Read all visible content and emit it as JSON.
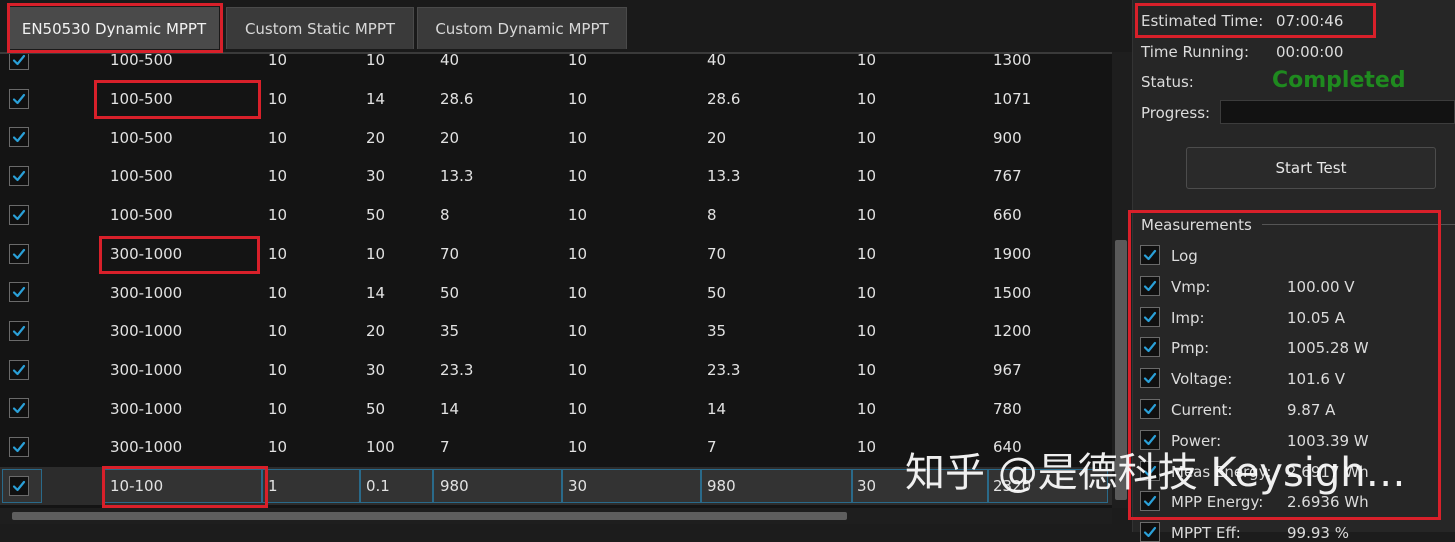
{
  "tabs": [
    {
      "label": "EN50530 Dynamic MPPT",
      "active": true
    },
    {
      "label": "Custom Static MPPT",
      "active": false
    },
    {
      "label": "Custom Dynamic MPPT",
      "active": false
    }
  ],
  "table": {
    "rows": [
      {
        "checked": true,
        "cells": [
          "100-500",
          "10",
          "10",
          "40",
          "10",
          "40",
          "10",
          "1300"
        ]
      },
      {
        "checked": true,
        "cells": [
          "100-500",
          "10",
          "14",
          "28.6",
          "10",
          "28.6",
          "10",
          "1071"
        ]
      },
      {
        "checked": true,
        "cells": [
          "100-500",
          "10",
          "20",
          "20",
          "10",
          "20",
          "10",
          "900"
        ]
      },
      {
        "checked": true,
        "cells": [
          "100-500",
          "10",
          "30",
          "13.3",
          "10",
          "13.3",
          "10",
          "767"
        ]
      },
      {
        "checked": true,
        "cells": [
          "100-500",
          "10",
          "50",
          "8",
          "10",
          "8",
          "10",
          "660"
        ]
      },
      {
        "checked": true,
        "cells": [
          "300-1000",
          "10",
          "10",
          "70",
          "10",
          "70",
          "10",
          "1900"
        ]
      },
      {
        "checked": true,
        "cells": [
          "300-1000",
          "10",
          "14",
          "50",
          "10",
          "50",
          "10",
          "1500"
        ]
      },
      {
        "checked": true,
        "cells": [
          "300-1000",
          "10",
          "20",
          "35",
          "10",
          "35",
          "10",
          "1200"
        ]
      },
      {
        "checked": true,
        "cells": [
          "300-1000",
          "10",
          "30",
          "23.3",
          "10",
          "23.3",
          "10",
          "967"
        ]
      },
      {
        "checked": true,
        "cells": [
          "300-1000",
          "10",
          "50",
          "14",
          "10",
          "14",
          "10",
          "780"
        ]
      },
      {
        "checked": true,
        "cells": [
          "300-1000",
          "10",
          "100",
          "7",
          "10",
          "7",
          "10",
          "640"
        ]
      },
      {
        "checked": true,
        "selected": true,
        "cells": [
          "10-100",
          "1",
          "0.1",
          "980",
          "30",
          "980",
          "30",
          "2320"
        ]
      }
    ]
  },
  "info": {
    "estimated_time_label": "Estimated Time:",
    "estimated_time": "07:00:46",
    "time_running_label": "Time Running:",
    "time_running": "00:00:00",
    "status_label": "Status:",
    "status": "Completed",
    "progress_label": "Progress:"
  },
  "start_button": "Start Test",
  "measurements": {
    "title": "Measurements",
    "items": [
      {
        "label": "Log",
        "value": "",
        "checked": true
      },
      {
        "label": "Vmp:",
        "value": "100.00 V",
        "checked": true
      },
      {
        "label": "Imp:",
        "value": "10.05 A",
        "checked": true
      },
      {
        "label": "Pmp:",
        "value": "1005.28 W",
        "checked": true
      },
      {
        "label": "Voltage:",
        "value": "101.6 V",
        "checked": true
      },
      {
        "label": "Current:",
        "value": "9.87 A",
        "checked": true
      },
      {
        "label": "Power:",
        "value": "1003.39 W",
        "checked": true
      },
      {
        "label": "Meas Energy:",
        "value": "2.6917 Wh",
        "checked": true
      },
      {
        "label": "MPP Energy:",
        "value": "2.6936 Wh",
        "checked": true
      },
      {
        "label": "MPPT Eff:",
        "value": "99.93 %",
        "checked": true
      }
    ]
  },
  "watermark": "知乎 @是德科技 Keysigh…",
  "colors": {
    "status_completed": "#1f8a1f",
    "highlight": "#d8202a",
    "check": "#2aa0d8"
  }
}
